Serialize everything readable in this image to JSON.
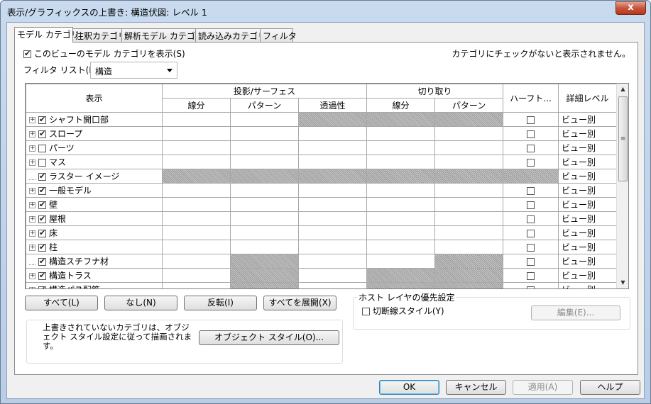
{
  "window": {
    "title": "表示/グラフィックスの上書き: 構造伏図: レベル 1",
    "close_label": "x"
  },
  "tabs": [
    "モデル カテゴリ",
    "注釈カテゴリ",
    "解析モデル カテゴリ",
    "読み込みカテゴリ",
    "フィルタ"
  ],
  "active_tab": 0,
  "show_model_label": "このビューのモデル カテゴリを表示(S)",
  "show_model_checked": true,
  "unchecked_note": "カテゴリにチェックがないと表示されません。",
  "filter_list": {
    "label": "フィルタ リスト(F):",
    "value": "構造"
  },
  "table": {
    "headers": {
      "display": "表示",
      "projection": "投影/サーフェス",
      "cut": "切り取り",
      "halftone": "ハーフト...",
      "detail_level": "詳細レベル",
      "proj_line": "線分",
      "proj_pattern": "パターン",
      "proj_transparency": "透過性",
      "cut_line": "線分",
      "cut_pattern": "パターン"
    },
    "rows": [
      {
        "name": "シャフト開口部",
        "checked": true,
        "expand": true,
        "detail": "ビュー別"
      },
      {
        "name": "スロープ",
        "checked": true,
        "expand": true,
        "detail": "ビュー別"
      },
      {
        "name": "パーツ",
        "checked": false,
        "expand": true,
        "detail": "ビュー別"
      },
      {
        "name": "マス",
        "checked": false,
        "expand": true,
        "detail": "ビュー別"
      },
      {
        "name": "ラスター イメージ",
        "checked": true,
        "expand": false,
        "detail": "ビュー別"
      },
      {
        "name": "一般モデル",
        "checked": true,
        "expand": true,
        "detail": "ビュー別"
      },
      {
        "name": "壁",
        "checked": true,
        "expand": true,
        "detail": "ビュー別"
      },
      {
        "name": "屋根",
        "checked": true,
        "expand": true,
        "detail": "ビュー別"
      },
      {
        "name": "床",
        "checked": true,
        "expand": true,
        "detail": "ビュー別"
      },
      {
        "name": "柱",
        "checked": true,
        "expand": true,
        "detail": "ビュー別"
      },
      {
        "name": "構造スチフナ材",
        "checked": true,
        "expand": false,
        "detail": "ビュー別"
      },
      {
        "name": "構造トラス",
        "checked": true,
        "expand": true,
        "detail": "ビュー別"
      },
      {
        "name": "構造パス配筋",
        "checked": true,
        "expand": true,
        "detail": "ビュー別"
      }
    ]
  },
  "buttons": {
    "all": "すべて(L)",
    "none": "なし(N)",
    "invert": "反転(I)",
    "expand_all": "すべてを展開(X)",
    "object_styles": "オブジェクト スタイル(O)...",
    "edit": "編集(E)...",
    "ok": "OK",
    "cancel": "キャンセル",
    "apply": "適用(A)",
    "help": "ヘルプ"
  },
  "note_text": "上書きされていないカテゴリは、オブジェクト スタイル設定に従って描画されます。",
  "host_layer": {
    "title": "ホスト レイヤの優先設定",
    "cut_line_styles": "切断線スタイル(Y)",
    "checked": false
  }
}
